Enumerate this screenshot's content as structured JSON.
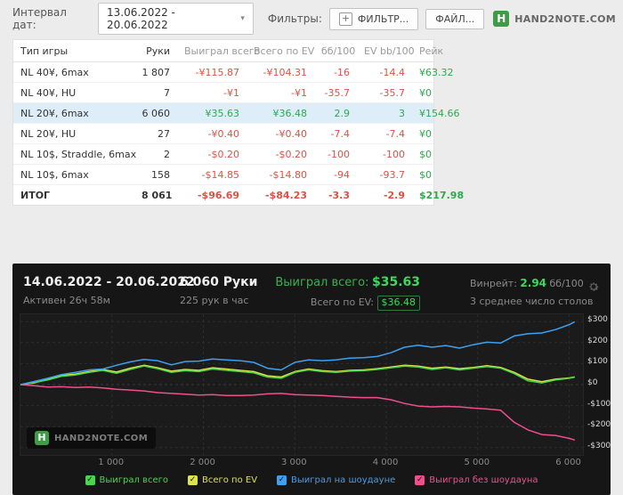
{
  "toolbar": {
    "date_label": "Интервал дат:",
    "date_range": "13.06.2022 - 20.06.2022",
    "chevron": "▾",
    "filters_label": "Фильтры:",
    "filter_plus_icon": "+",
    "filter_button": "ФИЛЬТР...",
    "file_button": "ФАЙЛ...",
    "brand_letter": "H",
    "brand": "HAND2NOTE.COM"
  },
  "table": {
    "columns": [
      "Тип игры",
      "Руки",
      "Выиграл всего",
      "Всего по EV",
      "бб/100",
      "EV bb/100",
      "Рейк"
    ],
    "rows": [
      {
        "cells": [
          "NL 40¥, 6max",
          "1 807",
          "-¥115.87",
          "-¥104.31",
          "-16",
          "-14.4",
          "¥63.32"
        ],
        "highlight": false,
        "bold": false
      },
      {
        "cells": [
          "NL 40¥, HU",
          "7",
          "-¥1",
          "-¥1",
          "-35.7",
          "-35.7",
          "¥0"
        ],
        "highlight": false,
        "bold": false
      },
      {
        "cells": [
          "NL 20¥, 6max",
          "6 060",
          "¥35.63",
          "¥36.48",
          "2.9",
          "3",
          "¥154.66"
        ],
        "highlight": true,
        "bold": false
      },
      {
        "cells": [
          "NL 20¥, HU",
          "27",
          "-¥0.40",
          "-¥0.40",
          "-7.4",
          "-7.4",
          "¥0"
        ],
        "highlight": false,
        "bold": false
      },
      {
        "cells": [
          "NL 10$, Straddle, 6max",
          "2",
          "-$0.20",
          "-$0.20",
          "-100",
          "-100",
          "$0"
        ],
        "highlight": false,
        "bold": false
      },
      {
        "cells": [
          "NL 10$, 6max",
          "158",
          "-$14.85",
          "-$14.80",
          "-94",
          "-93.7",
          "$0"
        ],
        "highlight": false,
        "bold": false
      },
      {
        "cells": [
          "ИТОГ",
          "8 061",
          "-$96.69",
          "-$84.23",
          "-3.3",
          "-2.9",
          "$217.98"
        ],
        "highlight": false,
        "bold": true
      }
    ],
    "colors": {
      "negative": "#dd5145",
      "positive": "#2fa84f",
      "highlight_row": "#ddeef9"
    }
  },
  "panel": {
    "date_range": "14.06.2022 - 20.06.2022",
    "active": "Активен 26ч 58м",
    "hands": "6 060 Руки",
    "hands_per_hour": "225 рук в час",
    "won_label": "Выиграл всего:",
    "won_value": "$35.63",
    "ev_label": "Всего по EV:",
    "ev_value": "$36.48",
    "winrate_label": "Винрейт:",
    "winrate_value": "2.94",
    "winrate_unit": "бб/100",
    "tables_avg": "3 среднее число столов",
    "watermark_letter": "H",
    "watermark": "HAND2NOTE.COM",
    "accent_green": "#3ed95c"
  },
  "chart_data": {
    "type": "line",
    "x_axis": {
      "range": [
        0,
        6150
      ],
      "ticks": [
        {
          "value": 1000,
          "label": "1 000"
        },
        {
          "value": 2000,
          "label": "2 000"
        },
        {
          "value": 3000,
          "label": "3 000"
        },
        {
          "value": 4000,
          "label": "4 000"
        },
        {
          "value": 5000,
          "label": "5 000"
        },
        {
          "value": 6000,
          "label": "6 000"
        }
      ]
    },
    "y_axis": {
      "range": [
        -335,
        335
      ],
      "ticks": [
        {
          "value": 300,
          "label": "$300"
        },
        {
          "value": 200,
          "label": "$200"
        },
        {
          "value": 100,
          "label": "$100"
        },
        {
          "value": 0,
          "label": "$0"
        },
        {
          "value": -100,
          "label": "-$100"
        },
        {
          "value": -200,
          "label": "-$200"
        },
        {
          "value": -300,
          "label": "-$300"
        }
      ]
    },
    "grid": "dashed",
    "legend_position": "bottom",
    "series": [
      {
        "id": "won-total",
        "name": "Выиграл всего",
        "color": "#4ad54c",
        "z": 3,
        "points": [
          [
            0,
            0
          ],
          [
            150,
            10
          ],
          [
            300,
            22
          ],
          [
            450,
            40
          ],
          [
            600,
            46
          ],
          [
            750,
            58
          ],
          [
            900,
            68
          ],
          [
            1050,
            54
          ],
          [
            1200,
            72
          ],
          [
            1350,
            88
          ],
          [
            1500,
            76
          ],
          [
            1650,
            58
          ],
          [
            1800,
            66
          ],
          [
            1950,
            62
          ],
          [
            2100,
            74
          ],
          [
            2250,
            68
          ],
          [
            2400,
            62
          ],
          [
            2550,
            56
          ],
          [
            2700,
            36
          ],
          [
            2850,
            30
          ],
          [
            3000,
            58
          ],
          [
            3150,
            70
          ],
          [
            3300,
            62
          ],
          [
            3450,
            58
          ],
          [
            3600,
            64
          ],
          [
            3750,
            66
          ],
          [
            3900,
            72
          ],
          [
            4050,
            80
          ],
          [
            4200,
            88
          ],
          [
            4350,
            84
          ],
          [
            4500,
            72
          ],
          [
            4650,
            80
          ],
          [
            4800,
            70
          ],
          [
            4950,
            78
          ],
          [
            5100,
            86
          ],
          [
            5250,
            78
          ],
          [
            5400,
            52
          ],
          [
            5550,
            18
          ],
          [
            5700,
            8
          ],
          [
            5850,
            22
          ],
          [
            6000,
            30
          ],
          [
            6060,
            35.63
          ]
        ]
      },
      {
        "id": "total-ev",
        "name": "Всего по EV",
        "color": "#dde24d",
        "z": 2,
        "points": [
          [
            0,
            0
          ],
          [
            150,
            8
          ],
          [
            300,
            26
          ],
          [
            450,
            44
          ],
          [
            600,
            50
          ],
          [
            750,
            62
          ],
          [
            900,
            72
          ],
          [
            1050,
            60
          ],
          [
            1200,
            78
          ],
          [
            1350,
            92
          ],
          [
            1500,
            80
          ],
          [
            1650,
            64
          ],
          [
            1800,
            72
          ],
          [
            1950,
            68
          ],
          [
            2100,
            80
          ],
          [
            2250,
            74
          ],
          [
            2400,
            68
          ],
          [
            2550,
            62
          ],
          [
            2700,
            42
          ],
          [
            2850,
            36
          ],
          [
            3000,
            62
          ],
          [
            3150,
            74
          ],
          [
            3300,
            66
          ],
          [
            3450,
            62
          ],
          [
            3600,
            68
          ],
          [
            3750,
            70
          ],
          [
            3900,
            76
          ],
          [
            4050,
            84
          ],
          [
            4200,
            92
          ],
          [
            4350,
            88
          ],
          [
            4500,
            78
          ],
          [
            4650,
            84
          ],
          [
            4800,
            76
          ],
          [
            4950,
            82
          ],
          [
            5100,
            90
          ],
          [
            5250,
            82
          ],
          [
            5400,
            58
          ],
          [
            5550,
            26
          ],
          [
            5700,
            14
          ],
          [
            5850,
            26
          ],
          [
            6000,
            32
          ],
          [
            6060,
            36.48
          ]
        ]
      },
      {
        "id": "won-showdown",
        "name": "Выиграл на шоудауне",
        "color": "#3fa0f0",
        "z": 4,
        "points": [
          [
            0,
            0
          ],
          [
            150,
            15
          ],
          [
            300,
            30
          ],
          [
            450,
            48
          ],
          [
            600,
            58
          ],
          [
            750,
            70
          ],
          [
            900,
            74
          ],
          [
            1050,
            92
          ],
          [
            1200,
            108
          ],
          [
            1350,
            120
          ],
          [
            1500,
            114
          ],
          [
            1650,
            94
          ],
          [
            1800,
            110
          ],
          [
            1950,
            112
          ],
          [
            2100,
            122
          ],
          [
            2250,
            118
          ],
          [
            2400,
            114
          ],
          [
            2550,
            106
          ],
          [
            2700,
            78
          ],
          [
            2850,
            70
          ],
          [
            3000,
            106
          ],
          [
            3150,
            118
          ],
          [
            3300,
            114
          ],
          [
            3450,
            118
          ],
          [
            3600,
            126
          ],
          [
            3750,
            128
          ],
          [
            3900,
            134
          ],
          [
            4050,
            152
          ],
          [
            4200,
            178
          ],
          [
            4350,
            188
          ],
          [
            4500,
            178
          ],
          [
            4650,
            186
          ],
          [
            4800,
            174
          ],
          [
            4950,
            190
          ],
          [
            5100,
            202
          ],
          [
            5250,
            198
          ],
          [
            5400,
            232
          ],
          [
            5550,
            242
          ],
          [
            5700,
            246
          ],
          [
            5850,
            262
          ],
          [
            6000,
            286
          ],
          [
            6060,
            299
          ]
        ]
      },
      {
        "id": "won-no-showdown",
        "name": "Выиграл без шоудауна",
        "color": "#ef4f8b",
        "z": 1,
        "points": [
          [
            0,
            0
          ],
          [
            150,
            -5
          ],
          [
            300,
            -12
          ],
          [
            450,
            -10
          ],
          [
            600,
            -14
          ],
          [
            750,
            -12
          ],
          [
            900,
            -16
          ],
          [
            1050,
            -22
          ],
          [
            1200,
            -26
          ],
          [
            1350,
            -30
          ],
          [
            1500,
            -38
          ],
          [
            1650,
            -42
          ],
          [
            1800,
            -46
          ],
          [
            1950,
            -50
          ],
          [
            2100,
            -48
          ],
          [
            2250,
            -52
          ],
          [
            2400,
            -52
          ],
          [
            2550,
            -50
          ],
          [
            2700,
            -44
          ],
          [
            2850,
            -42
          ],
          [
            3000,
            -48
          ],
          [
            3150,
            -50
          ],
          [
            3300,
            -52
          ],
          [
            3450,
            -56
          ],
          [
            3600,
            -60
          ],
          [
            3750,
            -62
          ],
          [
            3900,
            -62
          ],
          [
            4050,
            -72
          ],
          [
            4200,
            -90
          ],
          [
            4350,
            -102
          ],
          [
            4500,
            -106
          ],
          [
            4650,
            -104
          ],
          [
            4800,
            -106
          ],
          [
            4950,
            -112
          ],
          [
            5100,
            -116
          ],
          [
            5250,
            -122
          ],
          [
            5400,
            -180
          ],
          [
            5550,
            -216
          ],
          [
            5700,
            -238
          ],
          [
            5850,
            -242
          ],
          [
            6000,
            -256
          ],
          [
            6060,
            -264
          ]
        ]
      }
    ]
  }
}
